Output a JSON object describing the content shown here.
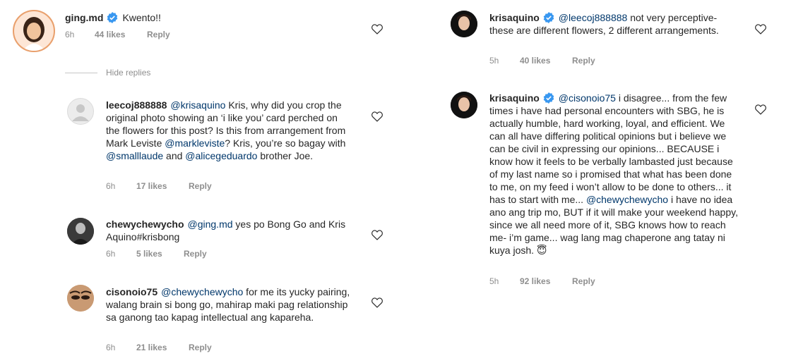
{
  "left": {
    "top_comment": {
      "username": "ging.md",
      "text": "Kwento!!",
      "time": "6h",
      "likes": "44 likes",
      "reply": "Reply"
    },
    "hide_replies": "Hide replies",
    "replies": [
      {
        "username": "leecoj888888",
        "mention": "@krisaquino",
        "text_1": " Kris, why did you crop the original photo showing an ‘i like you’ card perched on the flowers for this post? Is this from arrangement from Mark Leviste ",
        "mention_2": "@markleviste",
        "text_2": "? Kris, you’re so bagay with ",
        "mention_3": "@smalllaude",
        "text_3": " and ",
        "mention_4": "@alicegeduardo",
        "text_4": " brother Joe.",
        "time": "6h",
        "likes": "17 likes",
        "reply": "Reply"
      },
      {
        "username": "chewychewycho",
        "mention": "@ging.md",
        "text_1": " yes po Bong Go and Kris Aquino#krisbong",
        "time": "6h",
        "likes": "5 likes",
        "reply": "Reply"
      },
      {
        "username": "cisonoio75",
        "mention": "@chewychewycho",
        "text_1": " for me its yucky pairing, walang brain si bong go, mahirap maki pag relationship sa ganong tao kapag intellectual ang kapareha.",
        "time": "6h",
        "likes": "21 likes",
        "reply": "Reply"
      }
    ]
  },
  "right": {
    "comments": [
      {
        "username": "krisaquino",
        "mention": "@leecoj888888",
        "text_1": " not very perceptive- these are different flowers, 2 different arrangements.",
        "time": "5h",
        "likes": "40 likes",
        "reply": "Reply"
      },
      {
        "username": "krisaquino",
        "mention": "@cisonoio75",
        "text_1": " i disagree... from the few times i have had personal encounters with SBG, he is actually humble, hard working, loyal, and efficient. We can all have differing political opinions but i believe we can be civil in expressing our opinions... BECAUSE i know how it feels to be verbally lambasted just because of my last name so i promised that what has been done to me, on my feed i won’t allow to be done to others... it has to start with me... ",
        "mention_2": "@chewychewycho",
        "text_2": " i have no idea ano ang trip mo, BUT if it will make your weekend happy, since we all need more of it, SBG knows how to reach me- i’m game... wag lang mag chaperone ang tatay ni kuya josh. 😇",
        "time": "5h",
        "likes": "92 likes",
        "reply": "Reply"
      }
    ]
  },
  "colors": {
    "verified": "#3897f0",
    "mention": "#00376b",
    "meta": "#8e8e8e",
    "text": "#262626"
  },
  "icons": [
    "verified-badge-icon",
    "heart-icon",
    "avatar-placeholder-icon"
  ]
}
